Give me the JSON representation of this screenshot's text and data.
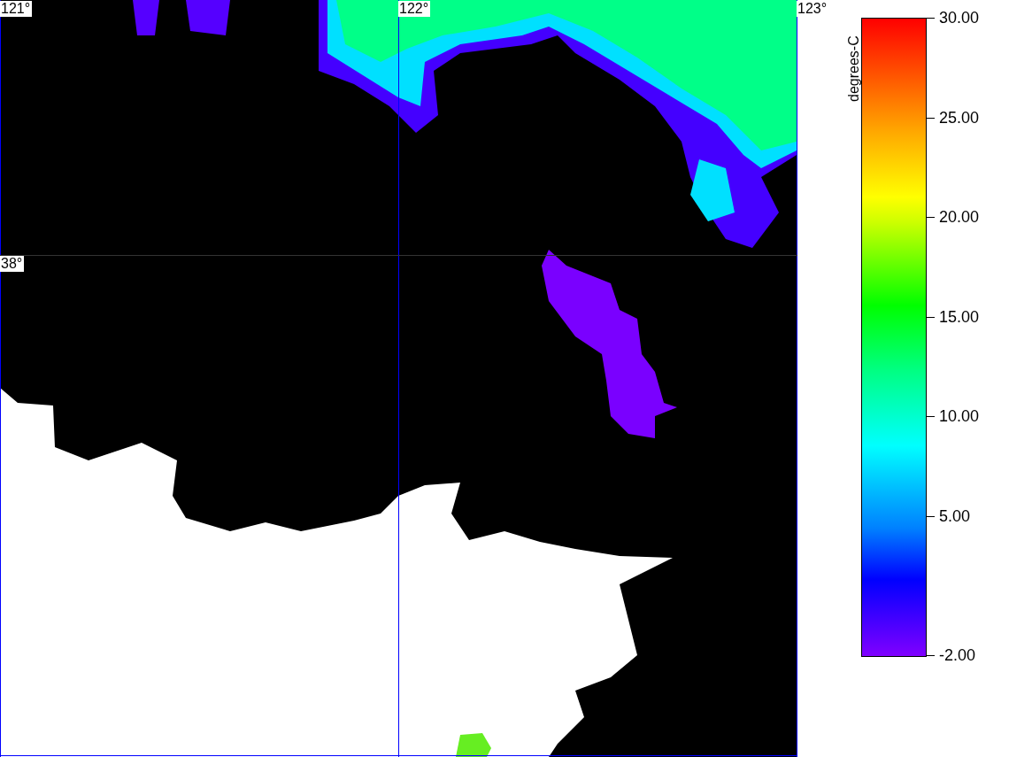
{
  "map": {
    "grid_labels": [
      {
        "kind": "longitude",
        "text": "121°"
      },
      {
        "kind": "longitude",
        "text": "122°"
      },
      {
        "kind": "longitude",
        "text": "123°"
      },
      {
        "kind": "latitude",
        "text": "38°"
      }
    ]
  },
  "colorbar": {
    "title": "degrees-C",
    "ticks": [
      "30.00",
      "25.00",
      "20.00",
      "15.00",
      "10.00",
      "5.00",
      "-2.00"
    ]
  }
}
